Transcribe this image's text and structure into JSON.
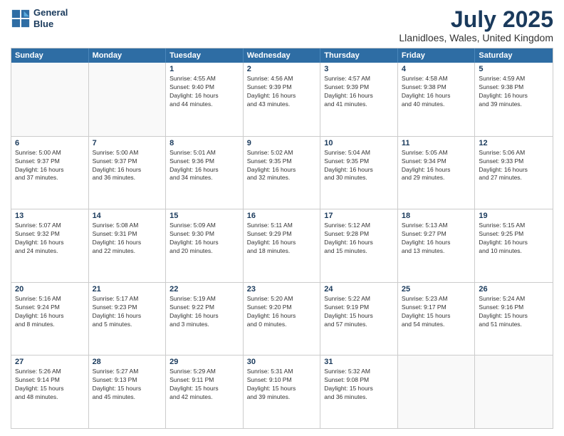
{
  "header": {
    "logo_line1": "General",
    "logo_line2": "Blue",
    "month_title": "July 2025",
    "location": "Llanidloes, Wales, United Kingdom"
  },
  "days_of_week": [
    "Sunday",
    "Monday",
    "Tuesday",
    "Wednesday",
    "Thursday",
    "Friday",
    "Saturday"
  ],
  "weeks": [
    [
      {
        "day": "",
        "info": ""
      },
      {
        "day": "",
        "info": ""
      },
      {
        "day": "1",
        "info": "Sunrise: 4:55 AM\nSunset: 9:40 PM\nDaylight: 16 hours\nand 44 minutes."
      },
      {
        "day": "2",
        "info": "Sunrise: 4:56 AM\nSunset: 9:39 PM\nDaylight: 16 hours\nand 43 minutes."
      },
      {
        "day": "3",
        "info": "Sunrise: 4:57 AM\nSunset: 9:39 PM\nDaylight: 16 hours\nand 41 minutes."
      },
      {
        "day": "4",
        "info": "Sunrise: 4:58 AM\nSunset: 9:38 PM\nDaylight: 16 hours\nand 40 minutes."
      },
      {
        "day": "5",
        "info": "Sunrise: 4:59 AM\nSunset: 9:38 PM\nDaylight: 16 hours\nand 39 minutes."
      }
    ],
    [
      {
        "day": "6",
        "info": "Sunrise: 5:00 AM\nSunset: 9:37 PM\nDaylight: 16 hours\nand 37 minutes."
      },
      {
        "day": "7",
        "info": "Sunrise: 5:00 AM\nSunset: 9:37 PM\nDaylight: 16 hours\nand 36 minutes."
      },
      {
        "day": "8",
        "info": "Sunrise: 5:01 AM\nSunset: 9:36 PM\nDaylight: 16 hours\nand 34 minutes."
      },
      {
        "day": "9",
        "info": "Sunrise: 5:02 AM\nSunset: 9:35 PM\nDaylight: 16 hours\nand 32 minutes."
      },
      {
        "day": "10",
        "info": "Sunrise: 5:04 AM\nSunset: 9:35 PM\nDaylight: 16 hours\nand 30 minutes."
      },
      {
        "day": "11",
        "info": "Sunrise: 5:05 AM\nSunset: 9:34 PM\nDaylight: 16 hours\nand 29 minutes."
      },
      {
        "day": "12",
        "info": "Sunrise: 5:06 AM\nSunset: 9:33 PM\nDaylight: 16 hours\nand 27 minutes."
      }
    ],
    [
      {
        "day": "13",
        "info": "Sunrise: 5:07 AM\nSunset: 9:32 PM\nDaylight: 16 hours\nand 24 minutes."
      },
      {
        "day": "14",
        "info": "Sunrise: 5:08 AM\nSunset: 9:31 PM\nDaylight: 16 hours\nand 22 minutes."
      },
      {
        "day": "15",
        "info": "Sunrise: 5:09 AM\nSunset: 9:30 PM\nDaylight: 16 hours\nand 20 minutes."
      },
      {
        "day": "16",
        "info": "Sunrise: 5:11 AM\nSunset: 9:29 PM\nDaylight: 16 hours\nand 18 minutes."
      },
      {
        "day": "17",
        "info": "Sunrise: 5:12 AM\nSunset: 9:28 PM\nDaylight: 16 hours\nand 15 minutes."
      },
      {
        "day": "18",
        "info": "Sunrise: 5:13 AM\nSunset: 9:27 PM\nDaylight: 16 hours\nand 13 minutes."
      },
      {
        "day": "19",
        "info": "Sunrise: 5:15 AM\nSunset: 9:25 PM\nDaylight: 16 hours\nand 10 minutes."
      }
    ],
    [
      {
        "day": "20",
        "info": "Sunrise: 5:16 AM\nSunset: 9:24 PM\nDaylight: 16 hours\nand 8 minutes."
      },
      {
        "day": "21",
        "info": "Sunrise: 5:17 AM\nSunset: 9:23 PM\nDaylight: 16 hours\nand 5 minutes."
      },
      {
        "day": "22",
        "info": "Sunrise: 5:19 AM\nSunset: 9:22 PM\nDaylight: 16 hours\nand 3 minutes."
      },
      {
        "day": "23",
        "info": "Sunrise: 5:20 AM\nSunset: 9:20 PM\nDaylight: 16 hours\nand 0 minutes."
      },
      {
        "day": "24",
        "info": "Sunrise: 5:22 AM\nSunset: 9:19 PM\nDaylight: 15 hours\nand 57 minutes."
      },
      {
        "day": "25",
        "info": "Sunrise: 5:23 AM\nSunset: 9:17 PM\nDaylight: 15 hours\nand 54 minutes."
      },
      {
        "day": "26",
        "info": "Sunrise: 5:24 AM\nSunset: 9:16 PM\nDaylight: 15 hours\nand 51 minutes."
      }
    ],
    [
      {
        "day": "27",
        "info": "Sunrise: 5:26 AM\nSunset: 9:14 PM\nDaylight: 15 hours\nand 48 minutes."
      },
      {
        "day": "28",
        "info": "Sunrise: 5:27 AM\nSunset: 9:13 PM\nDaylight: 15 hours\nand 45 minutes."
      },
      {
        "day": "29",
        "info": "Sunrise: 5:29 AM\nSunset: 9:11 PM\nDaylight: 15 hours\nand 42 minutes."
      },
      {
        "day": "30",
        "info": "Sunrise: 5:31 AM\nSunset: 9:10 PM\nDaylight: 15 hours\nand 39 minutes."
      },
      {
        "day": "31",
        "info": "Sunrise: 5:32 AM\nSunset: 9:08 PM\nDaylight: 15 hours\nand 36 minutes."
      },
      {
        "day": "",
        "info": ""
      },
      {
        "day": "",
        "info": ""
      }
    ]
  ]
}
